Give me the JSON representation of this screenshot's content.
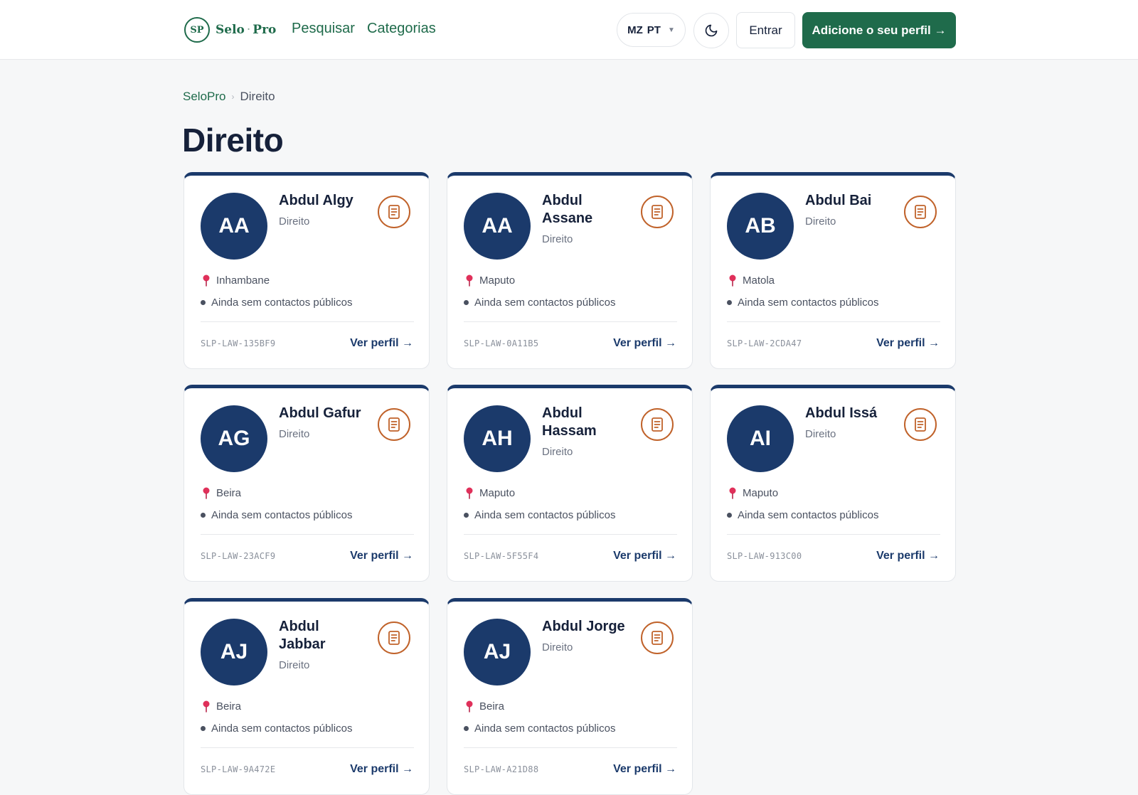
{
  "header": {
    "logo_badge": "SP",
    "logo_name_1": "Selo",
    "logo_sep": "·",
    "logo_name_2": "Pro",
    "nav": [
      "Pesquisar",
      "Categorias"
    ],
    "locale_flag": "MZ",
    "locale_lang": "PT",
    "login_label": "Entrar",
    "cta_label": "Adicione o seu perfil →"
  },
  "breadcrumb": {
    "home": "SeloPro",
    "current": "Direito"
  },
  "page": {
    "title": "Direito"
  },
  "cards": [
    {
      "initials": "AA",
      "name": "Abdul Algy",
      "category": "Direito",
      "location": "Inhambane",
      "contacts": "Ainda sem contactos públicos",
      "code": "SLP-LAW-135BF9",
      "link": "Ver perfil →"
    },
    {
      "initials": "AA",
      "name": "Abdul Assane",
      "category": "Direito",
      "location": "Maputo",
      "contacts": "Ainda sem contactos públicos",
      "code": "SLP-LAW-0A11B5",
      "link": "Ver perfil →"
    },
    {
      "initials": "AB",
      "name": "Abdul Bai",
      "category": "Direito",
      "location": "Matola",
      "contacts": "Ainda sem contactos públicos",
      "code": "SLP-LAW-2CDA47",
      "link": "Ver perfil →"
    },
    {
      "initials": "AG",
      "name": "Abdul Gafur",
      "category": "Direito",
      "location": "Beira",
      "contacts": "Ainda sem contactos públicos",
      "code": "SLP-LAW-23ACF9",
      "link": "Ver perfil →"
    },
    {
      "initials": "AH",
      "name": "Abdul Hassam",
      "category": "Direito",
      "location": "Maputo",
      "contacts": "Ainda sem contactos públicos",
      "code": "SLP-LAW-5F55F4",
      "link": "Ver perfil →"
    },
    {
      "initials": "AI",
      "name": "Abdul Issá",
      "category": "Direito",
      "location": "Maputo",
      "contacts": "Ainda sem contactos públicos",
      "code": "SLP-LAW-913C00",
      "link": "Ver perfil →"
    },
    {
      "initials": "AJ",
      "name": "Abdul Jabbar",
      "category": "Direito",
      "location": "Beira",
      "contacts": "Ainda sem contactos públicos",
      "code": "SLP-LAW-9A472E",
      "link": "Ver perfil →"
    },
    {
      "initials": "AJ",
      "name": "Abdul Jorge",
      "category": "Direito",
      "location": "Beira",
      "contacts": "Ainda sem contactos públicos",
      "code": "SLP-LAW-A21D88",
      "link": "Ver perfil →"
    }
  ],
  "colors": {
    "brand_green": "#1f6b4b",
    "navy": "#1b3a6b",
    "accent_orange": "#c0622a",
    "pin_pink": "#e0305a"
  }
}
